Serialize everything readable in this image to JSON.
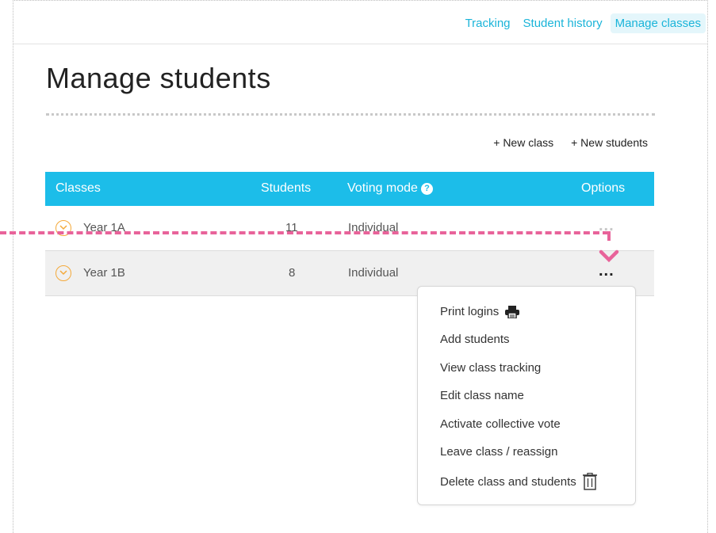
{
  "nav": {
    "links": [
      {
        "label": "Tracking",
        "active": false
      },
      {
        "label": "Student history",
        "active": false
      },
      {
        "label": "Manage classes",
        "active": true
      }
    ]
  },
  "page": {
    "title": "Manage students",
    "actions": {
      "new_class": "+ New class",
      "new_students": "+ New students"
    }
  },
  "table": {
    "headers": {
      "classes": "Classes",
      "students": "Students",
      "voting_mode": "Voting mode",
      "options": "Options"
    },
    "rows": [
      {
        "name": "Year 1A",
        "students": "11",
        "voting_mode": "Individual"
      },
      {
        "name": "Year 1B",
        "students": "8",
        "voting_mode": "Individual"
      }
    ],
    "options_glyph": "..."
  },
  "menu": {
    "items": [
      {
        "label": "Print logins",
        "icon": "printer-icon"
      },
      {
        "label": "Add students"
      },
      {
        "label": "View class tracking"
      },
      {
        "label": "Edit class name"
      },
      {
        "label": "Activate collective vote"
      },
      {
        "label": "Leave class / reassign"
      },
      {
        "label": "Delete class and students",
        "icon": "trash-icon"
      }
    ]
  },
  "colors": {
    "accent": "#1cbde9",
    "nav_link": "#1ab4d9",
    "highlight": "#e8639a",
    "chevron": "#f4a93a"
  }
}
